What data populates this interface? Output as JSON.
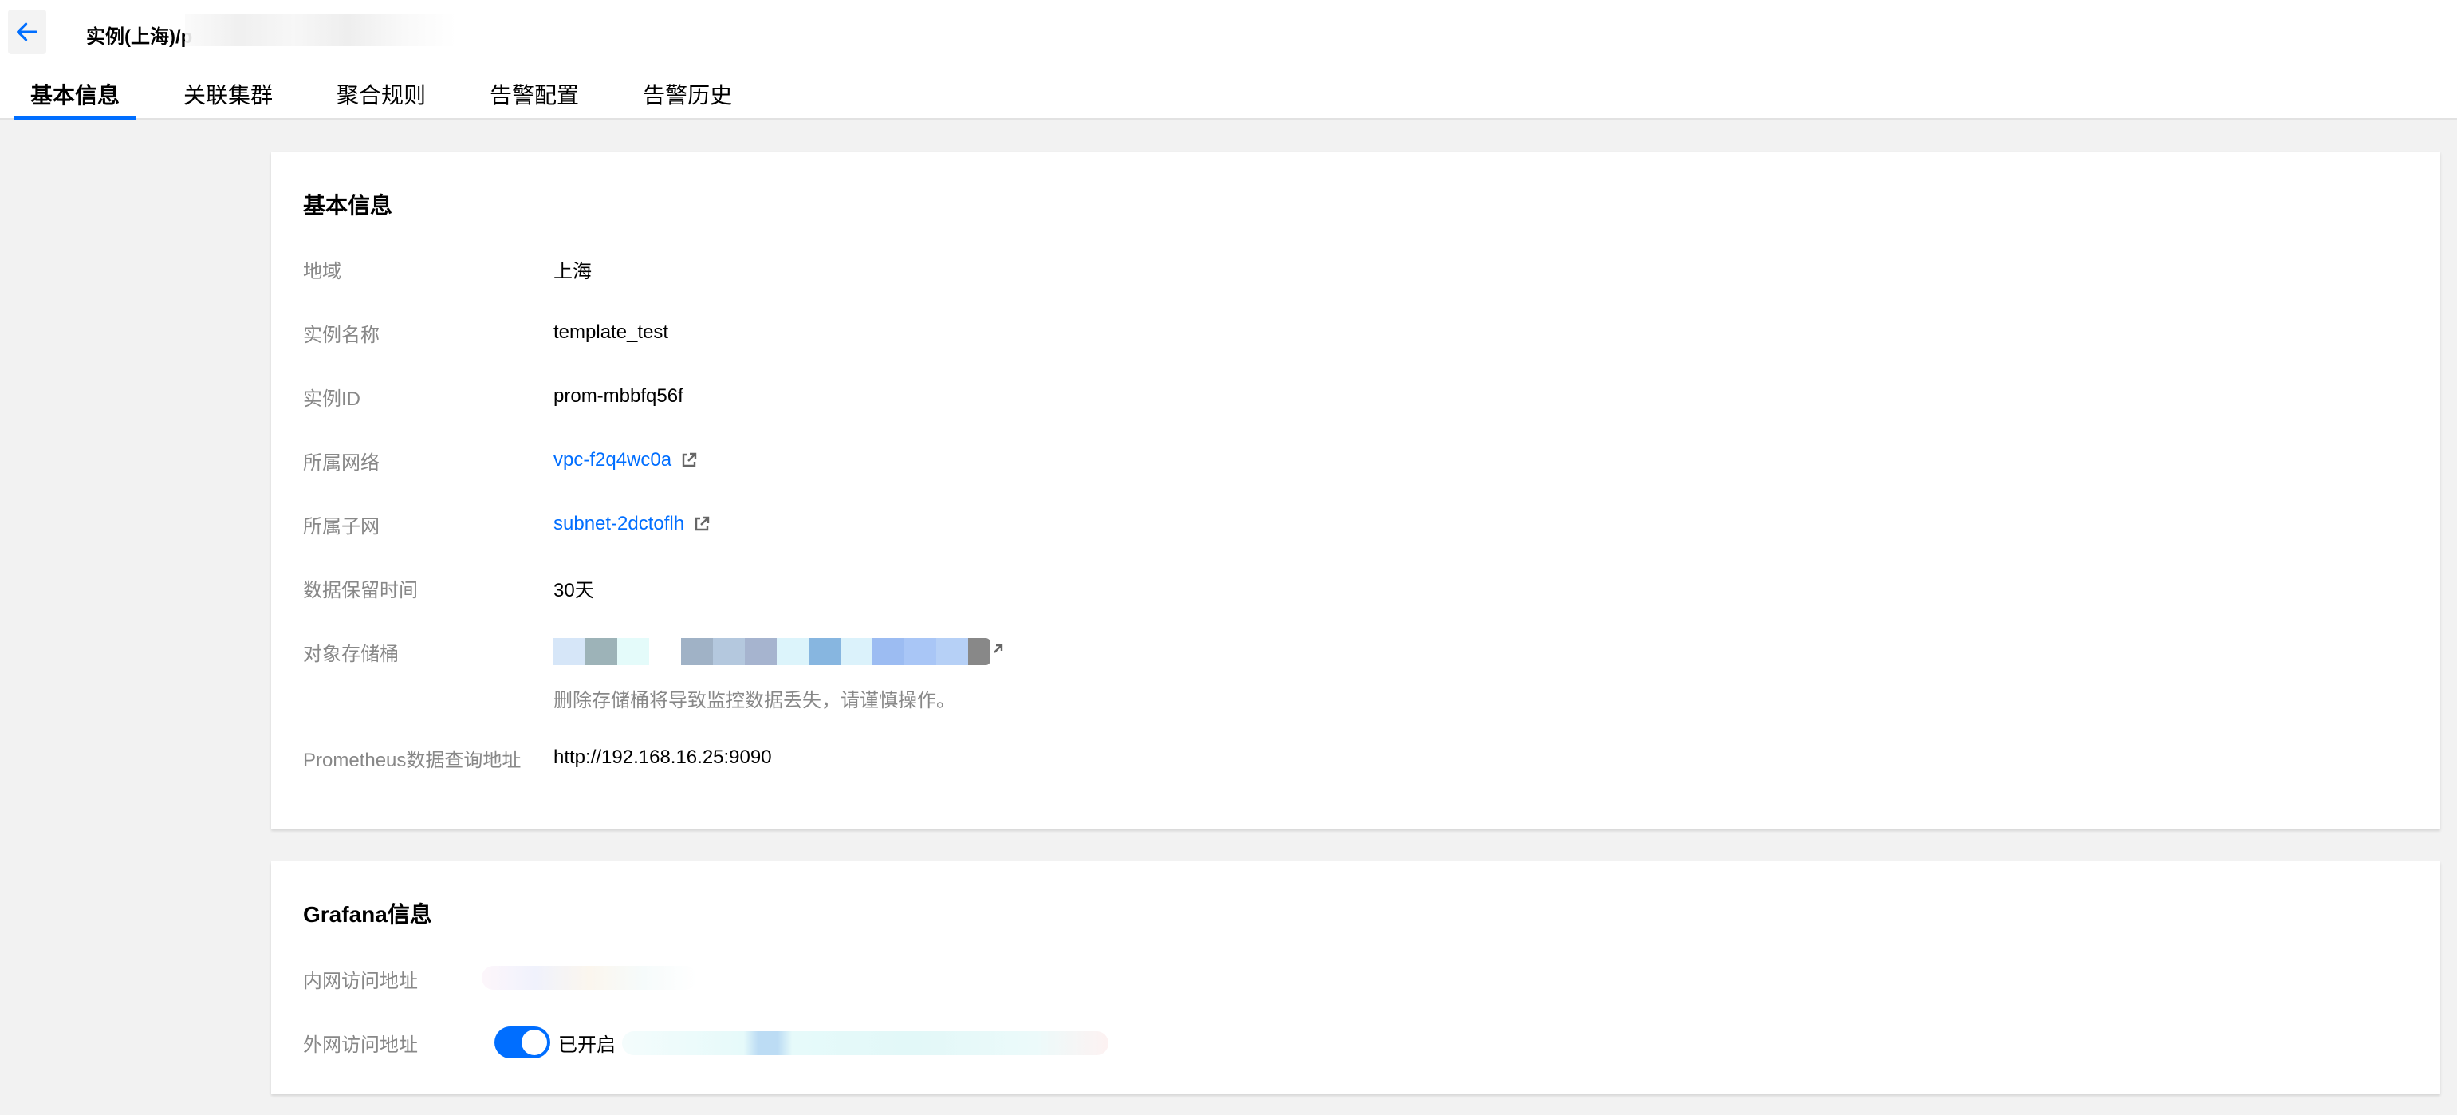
{
  "header": {
    "title": "实例(上海)/p",
    "tabs": [
      {
        "label": "基本信息",
        "active": true
      },
      {
        "label": "关联集群",
        "active": false
      },
      {
        "label": "聚合规则",
        "active": false
      },
      {
        "label": "告警配置",
        "active": false
      },
      {
        "label": "告警历史",
        "active": false
      }
    ]
  },
  "basic": {
    "title": "基本信息",
    "rows": [
      {
        "label": "地域",
        "value": "上海"
      },
      {
        "label": "实例名称",
        "value": "template_test"
      },
      {
        "label": "实例ID",
        "value": "prom-mbbfq56f"
      },
      {
        "label": "所属网络",
        "value": "vpc-f2q4wc0a"
      },
      {
        "label": "所属子网",
        "value": "subnet-2dctoflh"
      },
      {
        "label": "数据保留时间",
        "value": "30天"
      },
      {
        "label": "对象存储桶",
        "value": ""
      },
      {
        "label": "Prometheus数据查询地址",
        "value": "http://192.168.16.25:9090"
      }
    ],
    "bucket_hint": "删除存储桶将导致监控数据丢失，请谨慎操作。"
  },
  "grafana": {
    "title": "Grafana信息",
    "rows": [
      {
        "label": "内网访问地址"
      },
      {
        "label": "外网访问地址",
        "toggle_label": "已开启",
        "enabled": true
      }
    ]
  },
  "colors": {
    "accent": "#006eff",
    "label": "#888888",
    "background": "#f2f2f2"
  },
  "icons": {
    "back": "arrow-left-icon",
    "external": "external-link-icon"
  }
}
